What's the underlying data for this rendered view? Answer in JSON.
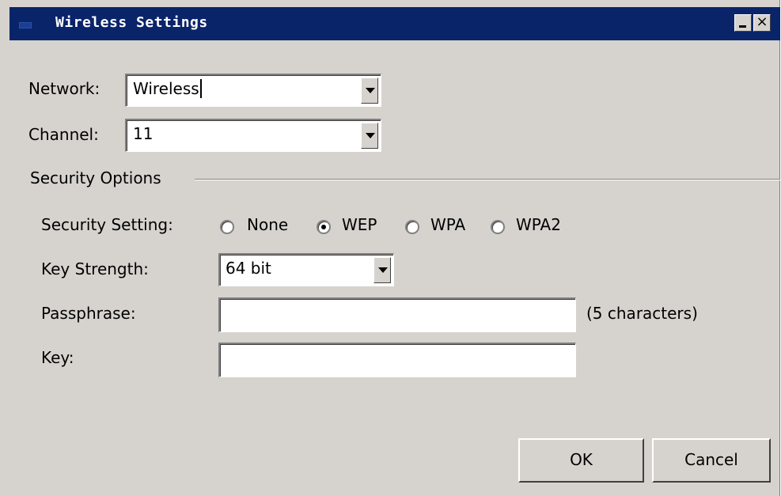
{
  "window": {
    "title": "Wireless Settings",
    "minimize_label": "_",
    "close_label": "×"
  },
  "network": {
    "label": "Network:",
    "value": "Wireless"
  },
  "channel": {
    "label": "Channel:",
    "value": "11"
  },
  "security": {
    "group_title": "Security Options",
    "setting_label": "Security Setting:",
    "options": [
      {
        "label": "None",
        "selected": false
      },
      {
        "label": "WEP",
        "selected": true
      },
      {
        "label": "WPA",
        "selected": false
      },
      {
        "label": "WPA2",
        "selected": false
      }
    ],
    "key_strength_label": "Key Strength:",
    "key_strength_value": "64 bit",
    "passphrase_label": "Passphrase:",
    "passphrase_value": "",
    "passphrase_hint": "(5 characters)",
    "key_label": "Key:",
    "key_value": ""
  },
  "buttons": {
    "ok": "OK",
    "cancel": "Cancel"
  }
}
